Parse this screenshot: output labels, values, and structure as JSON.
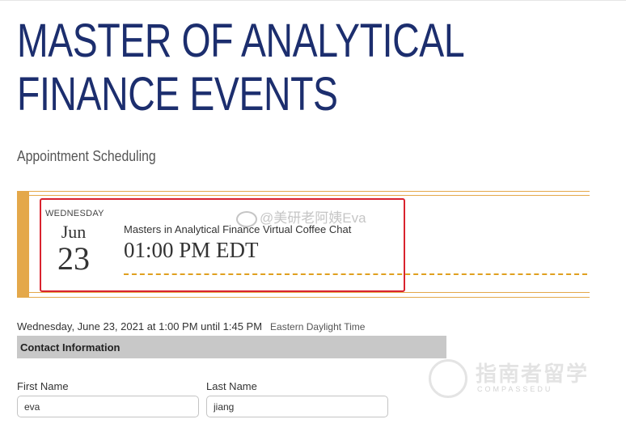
{
  "page": {
    "title": "MASTER OF ANALYTICAL FINANCE EVENTS",
    "subtitle": "Appointment Scheduling"
  },
  "event": {
    "weekday": "WEDNESDAY",
    "month": "Jun",
    "day": "23",
    "name": "Masters in Analytical Finance Virtual Coffee Chat",
    "time": "01:00 PM EDT"
  },
  "appointment": {
    "summary": "Wednesday, June 23, 2021 at 1:00 PM until 1:45 PM",
    "timezone": "Eastern Daylight Time"
  },
  "contact": {
    "section_title": "Contact Information",
    "first_name_label": "First Name",
    "first_name_value": "eva",
    "last_name_label": "Last Name",
    "last_name_value": "jiang"
  },
  "watermarks": {
    "weibo": "@美研老阿姨Eva",
    "brand_cn": "指南者留学",
    "brand_en": "COMPASSEDU"
  },
  "colors": {
    "title": "#1c2e6e",
    "accent": "#e4a84a",
    "highlight": "#d9232e",
    "section_bar": "#c8c8c8"
  }
}
